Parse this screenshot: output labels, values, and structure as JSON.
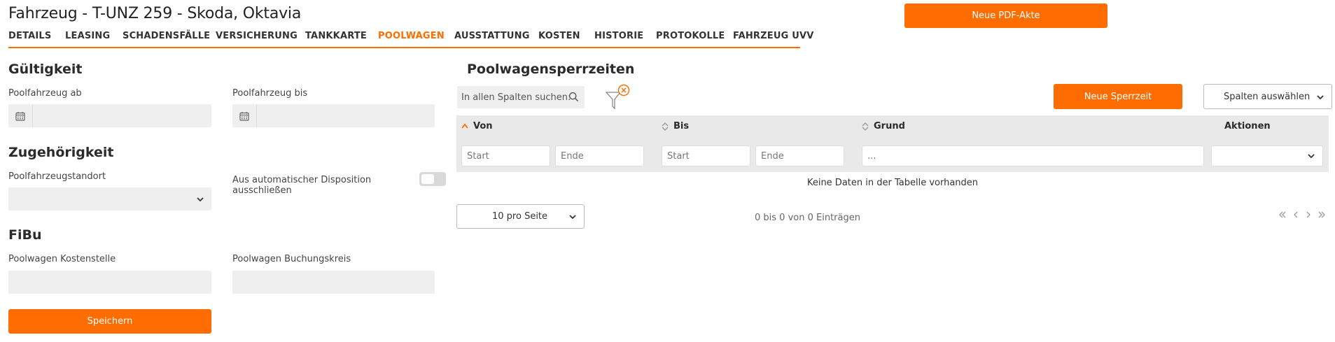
{
  "header": {
    "title": "Fahrzeug - T-UNZ 259 - Skoda, Oktavia",
    "pdf_button": "Neue PDF-Akte"
  },
  "tabs": [
    {
      "label": "DETAILS",
      "active": false
    },
    {
      "label": "LEASING",
      "active": false
    },
    {
      "label": "SCHADENSFÄLLE",
      "active": false
    },
    {
      "label": "VERSICHERUNG",
      "active": false
    },
    {
      "label": "TANKKARTE",
      "active": false
    },
    {
      "label": "POOLWAGEN",
      "active": true
    },
    {
      "label": "AUSSTATTUNG",
      "active": false
    },
    {
      "label": "KOSTEN",
      "active": false
    },
    {
      "label": "HISTORIE",
      "active": false
    },
    {
      "label": "PROTOKOLLE",
      "active": false
    },
    {
      "label": "FAHRZEUG UVV",
      "active": false
    }
  ],
  "gueltigkeit": {
    "heading": "Gültigkeit",
    "ab_label": "Poolfahrzeug ab",
    "ab_value": "",
    "bis_label": "Poolfahrzeug bis",
    "bis_value": ""
  },
  "zugehoerigkeit": {
    "heading": "Zugehörigkeit",
    "standort_label": "Poolfahrzeugstandort",
    "standort_value": "",
    "dispo_label_line1": "Aus automatischer Disposition",
    "dispo_label_line2": "ausschließen",
    "dispo_toggle": false
  },
  "fibu": {
    "heading": "FiBu",
    "kostenstelle_label": "Poolwagen Kostenstelle",
    "kostenstelle_value": "",
    "buchungskreis_label": "Poolwagen Buchungskreis",
    "buchungskreis_value": ""
  },
  "save_button": "Speichern",
  "sperrzeiten": {
    "heading": "Poolwagensperrzeiten",
    "search_placeholder": "In allen Spalten suchen:",
    "new_button": "Neue Sperrzeit",
    "columns_button": "Spalten auswählen",
    "columns": {
      "von": "Von",
      "bis": "Bis",
      "grund": "Grund",
      "aktionen": "Aktionen"
    },
    "filters": {
      "von_start": "Start",
      "von_ende": "Ende",
      "bis_start": "Start",
      "bis_ende": "Ende",
      "grund": "..."
    },
    "empty_text": "Keine Daten in der Tabelle vorhanden",
    "page_size": "10 pro Seite",
    "info": "0 bis 0 von 0 Einträgen"
  },
  "colors": {
    "accent": "#ff6c00",
    "field_bg": "#efefef",
    "table_head_bg": "#e9e9e9"
  }
}
